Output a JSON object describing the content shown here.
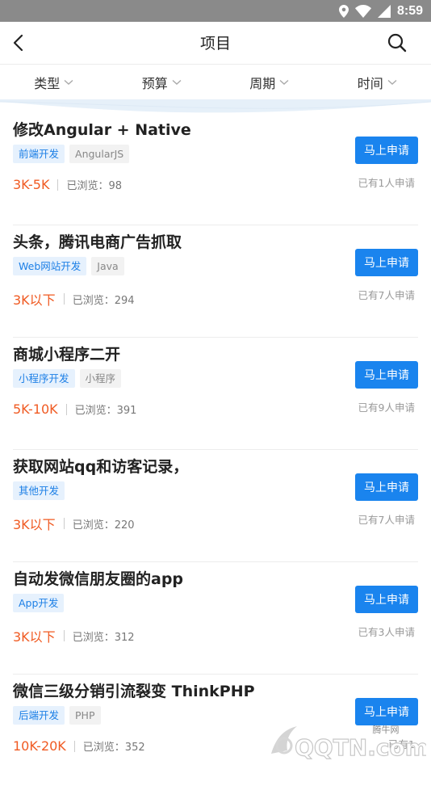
{
  "status_bar": {
    "time": "8:59"
  },
  "header": {
    "title": "项目"
  },
  "filters": [
    {
      "label": "类型"
    },
    {
      "label": "预算"
    },
    {
      "label": "周期"
    },
    {
      "label": "时间"
    }
  ],
  "apply_label": "马上申请",
  "projects": [
    {
      "title": "修改Angular + Native",
      "tags": [
        "前端开发",
        "AngularJS"
      ],
      "price": "3K-5K",
      "views": "已浏览：98",
      "applied": "已有1人申请"
    },
    {
      "title": "头条，腾讯电商广告抓取",
      "tags": [
        "Web网站开发",
        "Java"
      ],
      "price": "3K以下",
      "views": "已浏览：294",
      "applied": "已有7人申请"
    },
    {
      "title": "商城小程序二开",
      "tags": [
        "小程序开发",
        "小程序"
      ],
      "price": "5K-10K",
      "views": "已浏览：391",
      "applied": "已有9人申请"
    },
    {
      "title": "获取网站qq和访客记录，",
      "tags": [
        "其他开发"
      ],
      "price": "3K以下",
      "views": "已浏览：220",
      "applied": "已有7人申请"
    },
    {
      "title": "自动发微信朋友圈的app",
      "tags": [
        "App开发"
      ],
      "price": "3K以下",
      "views": "已浏览：312",
      "applied": "已有3人申请"
    },
    {
      "title": "微信三级分销引流裂变 ThinkPHP",
      "tags": [
        "后端开发",
        "PHP"
      ],
      "price": "10K-20K",
      "views": "已浏览：352",
      "applied": "已有1"
    }
  ],
  "watermark": {
    "brand": "腾牛网",
    "text": "QQTN.com"
  }
}
